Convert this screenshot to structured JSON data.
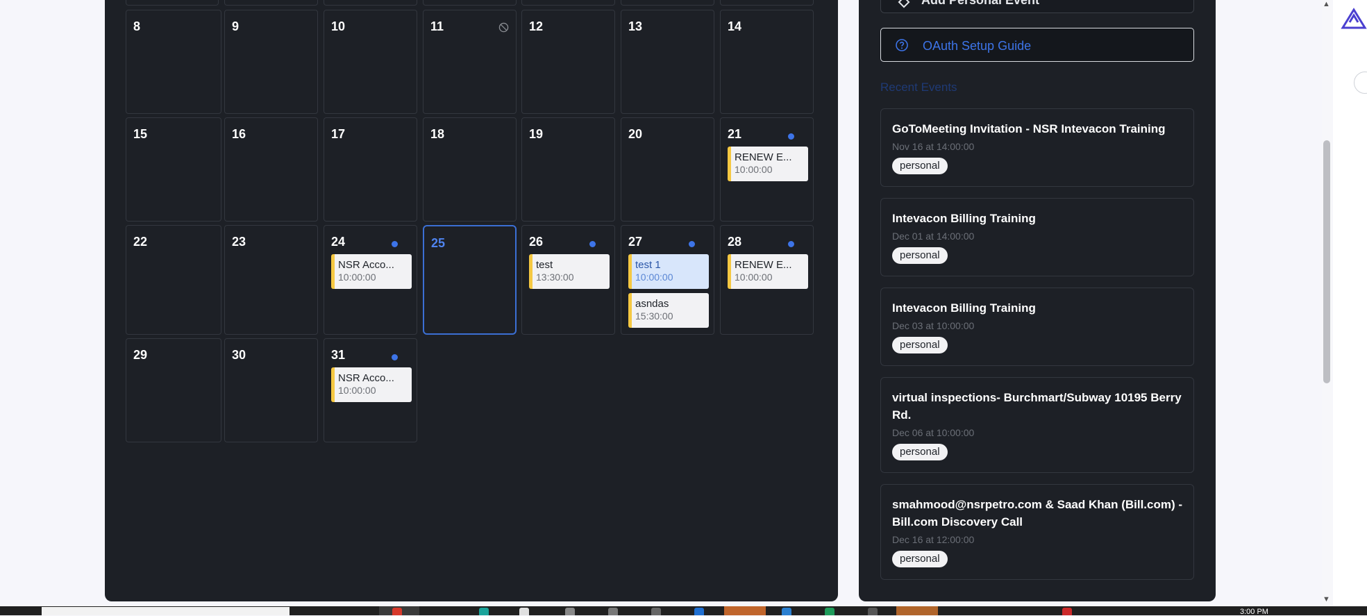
{
  "calendar": {
    "weeks": [
      {
        "days": [
          {
            "num": "8"
          },
          {
            "num": "9"
          },
          {
            "num": "10"
          },
          {
            "num": "11",
            "blocked": true
          },
          {
            "num": "12"
          },
          {
            "num": "13"
          },
          {
            "num": "14"
          }
        ]
      },
      {
        "days": [
          {
            "num": "15"
          },
          {
            "num": "16"
          },
          {
            "num": "17"
          },
          {
            "num": "18"
          },
          {
            "num": "19"
          },
          {
            "num": "20"
          },
          {
            "num": "21",
            "dot": true,
            "events": [
              {
                "title": "RENEW E...",
                "time": "10:00:00"
              }
            ]
          }
        ]
      },
      {
        "days": [
          {
            "num": "22"
          },
          {
            "num": "23"
          },
          {
            "num": "24",
            "dot": true,
            "events": [
              {
                "title": "NSR Acco...",
                "time": "10:00:00"
              }
            ]
          },
          {
            "num": "25",
            "today": true
          },
          {
            "num": "26",
            "dot": true,
            "events": [
              {
                "title": "test",
                "time": "13:30:00"
              }
            ]
          },
          {
            "num": "27",
            "dot": true,
            "events": [
              {
                "title": "test 1",
                "time": "10:00:00",
                "selected": true
              },
              {
                "title": "asndas",
                "time": "15:30:00"
              }
            ]
          },
          {
            "num": "28",
            "dot": true,
            "events": [
              {
                "title": "RENEW E...",
                "time": "10:00:00"
              }
            ]
          }
        ]
      },
      {
        "days": [
          {
            "num": "29"
          },
          {
            "num": "30"
          },
          {
            "num": "31",
            "dot": true,
            "events": [
              {
                "title": "NSR Acco...",
                "time": "10:00:00"
              }
            ]
          }
        ]
      }
    ],
    "event_accent": "#f5c842",
    "today_color": "#3b6fd4",
    "dot_color": "#3d74e8"
  },
  "sidebar": {
    "add_event_label": "Add Personal Event",
    "oauth_label": "OAuth Setup Guide",
    "recent_title": "Recent Events",
    "recent_events": [
      {
        "title": "GoToMeeting Invitation - NSR Intevacon Training",
        "date": "Nov 16 at 14:00:00",
        "tag": "personal"
      },
      {
        "title": "Intevacon Billing Training",
        "date": "Dec 01 at 14:00:00",
        "tag": "personal"
      },
      {
        "title": "Intevacon Billing Training",
        "date": "Dec 03 at 10:00:00",
        "tag": "personal"
      },
      {
        "title": "virtual inspections- Burchmart/Subway 10195 Berry Rd.",
        "date": "Dec 06 at 10:00:00",
        "tag": "personal"
      },
      {
        "title": "smahmood@nsrpetro.com & Saad Khan (Bill.com) - Bill.com Discovery Call",
        "date": "Dec 16 at 12:00:00",
        "tag": "personal"
      }
    ]
  },
  "taskbar": {
    "clock": "3:00 PM"
  },
  "icons": {
    "blocked": "blocked-circle-icon",
    "oauth": "question-circle-icon",
    "add": "diamond-icon"
  }
}
